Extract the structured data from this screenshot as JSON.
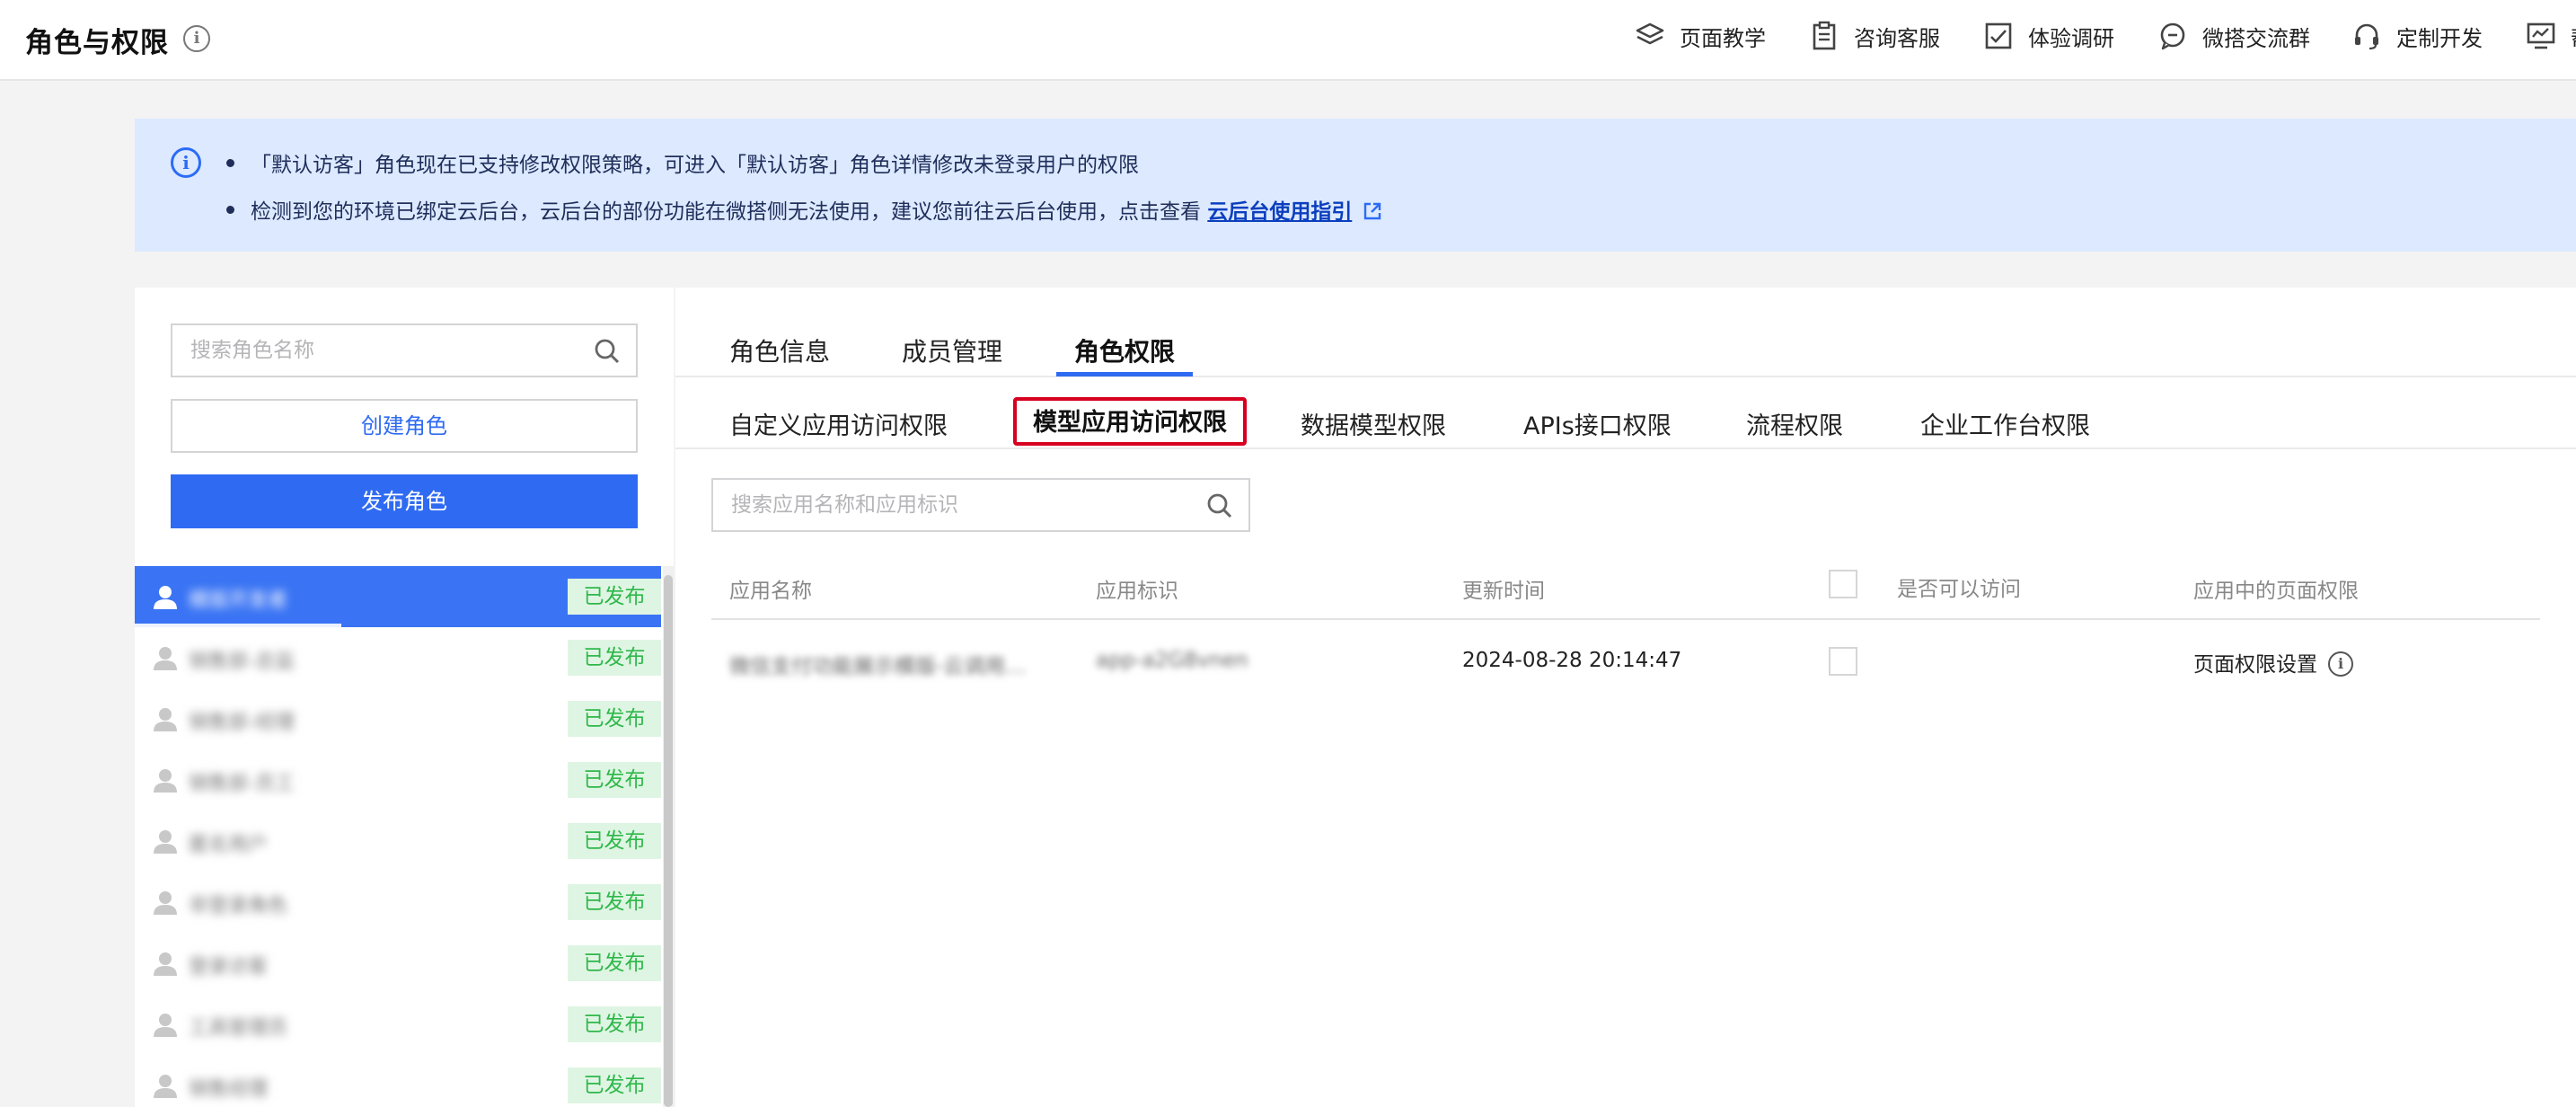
{
  "header": {
    "title": "角色与权限",
    "nav": [
      {
        "label": "页面教学",
        "icon": "layers-icon"
      },
      {
        "label": "咨询客服",
        "icon": "clipboard-icon"
      },
      {
        "label": "体验调研",
        "icon": "survey-check-icon"
      },
      {
        "label": "微搭交流群",
        "icon": "chat-bubble-icon"
      },
      {
        "label": "定制开发",
        "icon": "headset-icon"
      },
      {
        "label": "帮",
        "icon": "monitor-chart-icon"
      }
    ]
  },
  "notice": {
    "line1": "「默认访客」角色现在已支持修改权限策略，可进入「默认访客」角色详情修改未登录用户的权限",
    "line2_text": "检测到您的环境已绑定云后台，云后台的部份功能在微搭侧无法使用，建议您前往云后台使用，点击查看",
    "line2_link": "云后台使用指引"
  },
  "left": {
    "search_placeholder": "搜索角色名称",
    "create_label": "创建角色",
    "publish_label": "发布角色",
    "roles": [
      {
        "name": "模版开发者",
        "status": "已发布",
        "active": true
      },
      {
        "name": "销售部-总监",
        "status": "已发布"
      },
      {
        "name": "销售部-经理",
        "status": "已发布"
      },
      {
        "name": "销售部-员工",
        "status": "已发布"
      },
      {
        "name": "匿名用户",
        "status": "已发布"
      },
      {
        "name": "非登录角色",
        "status": "已发布"
      },
      {
        "name": "登录访客",
        "status": "已发布"
      },
      {
        "name": "工具管理员",
        "status": "已发布"
      },
      {
        "name": "销售经理",
        "status": "已发布"
      }
    ]
  },
  "right": {
    "tabs": [
      "角色信息",
      "成员管理",
      "角色权限"
    ],
    "active_tab": "角色权限",
    "sub_tabs": [
      "自定义应用访问权限",
      "模型应用访问权限",
      "数据模型权限",
      "APIs接口权限",
      "流程权限",
      "企业工作台权限"
    ],
    "active_sub_tab": "模型应用访问权限",
    "search_placeholder": "搜索应用名称和应用标识",
    "columns": [
      "应用名称",
      "应用标识",
      "更新时间",
      "是否可以访问",
      "应用中的页面权限"
    ],
    "rows": [
      {
        "name": "微信支付功能展示模版-云调用…",
        "id": "app-a2G8vnen",
        "updated": "2024-08-28 20:14:47",
        "action": "页面权限设置"
      }
    ]
  },
  "colors": {
    "accent": "#2f6bf2",
    "badge_text": "#2fb84a",
    "badge_bg": "#dff5e3",
    "highlight": "#d7001f",
    "notice_bg": "#dde9ff"
  }
}
